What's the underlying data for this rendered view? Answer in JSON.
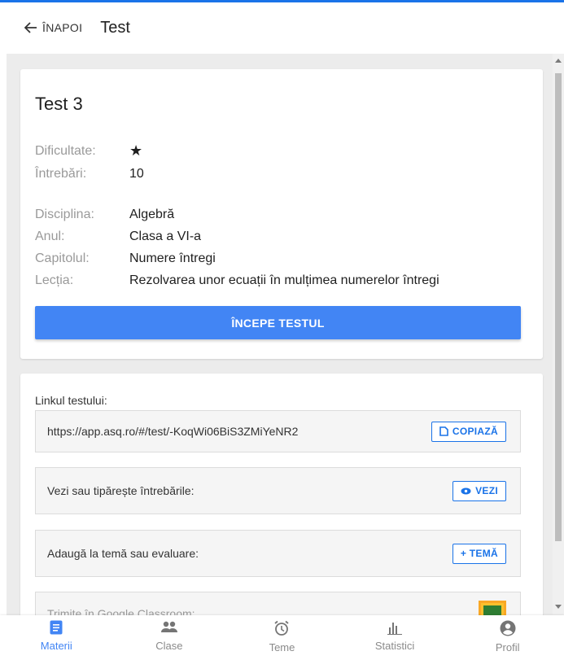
{
  "header": {
    "back_label": "ÎNAPOI",
    "title": "Test"
  },
  "test": {
    "name": "Test 3",
    "details": [
      {
        "label": "Dificultate:",
        "value": ""
      },
      {
        "label": "Întrebări:",
        "value": "10"
      },
      {
        "label": "Disciplina:",
        "value": "Algebră"
      },
      {
        "label": "Anul:",
        "value": "Clasa a VI-a"
      },
      {
        "label": "Capitolul:",
        "value": "Numere întregi"
      },
      {
        "label": "Lecția:",
        "value": "Rezolvarea unor ecuații în mulțimea numerelor întregi"
      }
    ],
    "difficulty_stars": 1,
    "start_label": "ÎNCEPE TESTUL"
  },
  "share": {
    "link_label": "Linkul testului:",
    "link_url": "https://app.asq.ro/#/test/-KoqWi06BiS3ZMiYeNR2",
    "copy_label": "COPIAZĂ",
    "view_text": "Vezi sau tipărește întrebările:",
    "view_label": "VEZI",
    "assign_text": "Adaugă la temă sau evaluare:",
    "assign_label": "+ TEMĂ",
    "classroom_text": "Trimite în Google Classroom:"
  },
  "nav": {
    "items": [
      {
        "label": "Materii",
        "icon": "book-icon",
        "active": true
      },
      {
        "label": "Clase",
        "icon": "people-icon",
        "active": false
      },
      {
        "label": "Teme",
        "icon": "alarm-icon",
        "active": false
      },
      {
        "label": "Statistici",
        "icon": "bar-chart-icon",
        "active": false
      },
      {
        "label": "Profil",
        "icon": "account-icon",
        "active": false
      }
    ]
  },
  "colors": {
    "accent": "#4285f4",
    "link": "#1a73e8",
    "background": "#ececec"
  }
}
